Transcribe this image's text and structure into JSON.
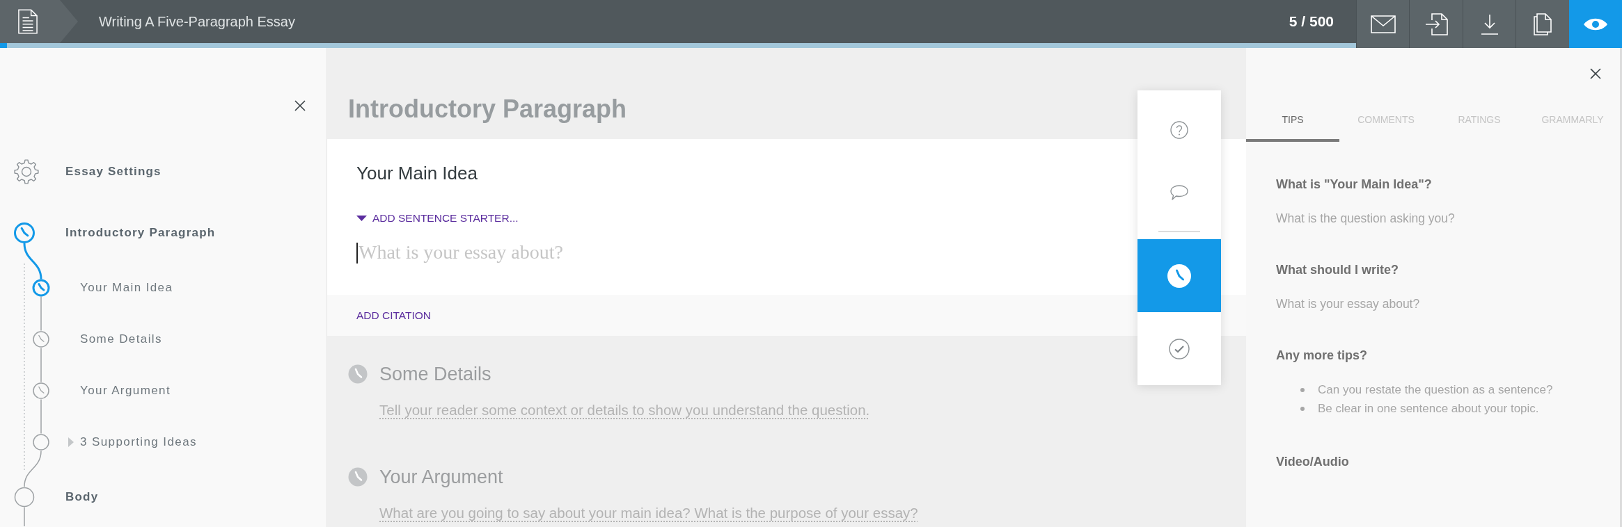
{
  "header": {
    "title": "Writing A Five-Paragraph Essay",
    "word_count": "5 / 500",
    "progress": {
      "level": 0.005
    },
    "actions": [
      {
        "kind": "email",
        "selected": false
      },
      {
        "kind": "import",
        "selected": false
      },
      {
        "kind": "download",
        "selected": false
      },
      {
        "kind": "copy",
        "selected": false
      },
      {
        "kind": "preview",
        "selected": true
      }
    ]
  },
  "sidebar": {
    "items": [
      {
        "kind": "settings",
        "label": "Essay Settings",
        "selected": false
      },
      {
        "kind": "section",
        "label": "Introductory Paragraph",
        "selected": true,
        "in_progress": true,
        "children": [
          {
            "label": "Your Main Idea",
            "selected": true,
            "in_progress": true
          },
          {
            "label": "Some Details",
            "selected": false,
            "in_progress": true
          },
          {
            "label": "Your Argument",
            "selected": false,
            "in_progress": true
          },
          {
            "label": "3 Supporting Ideas",
            "selected": false,
            "in_progress": false,
            "expanded": false
          }
        ]
      },
      {
        "kind": "section",
        "label": "Body",
        "selected": false,
        "in_progress": false
      }
    ]
  },
  "editor": {
    "title": "Introductory Paragraph",
    "current_step": {
      "title": "Your Main Idea",
      "starter_link": "ADD SENTENCE STARTER...",
      "placeholder": "What is your essay about?",
      "focused": true,
      "citation_link": "ADD CITATION"
    },
    "other_steps": [
      {
        "title": "Some Details",
        "prompt": "Tell your reader some context or details to show you understand the question.",
        "in_progress": true
      },
      {
        "title": "Your Argument",
        "prompt": "What are you going to say about your main idea? What is the purpose of your essay?",
        "in_progress": true
      }
    ]
  },
  "tool_rail": {
    "groups": [
      [
        {
          "kind": "help",
          "selected": false
        },
        {
          "kind": "comment",
          "selected": false
        }
      ],
      [
        {
          "kind": "progress",
          "selected": true
        },
        {
          "kind": "done",
          "selected": false
        }
      ]
    ]
  },
  "tips_panel": {
    "tabs": [
      {
        "label": "TIPS",
        "selected": true
      },
      {
        "label": "COMMENTS",
        "selected": false
      },
      {
        "label": "RATINGS",
        "selected": false
      },
      {
        "label": "GRAMMARLY",
        "selected": false
      }
    ],
    "sections": [
      {
        "kind": "text",
        "heading": "What is \"Your Main Idea\"?",
        "body": "What is the question asking you?"
      },
      {
        "kind": "text",
        "heading": "What should I write?",
        "body": "What is your essay about?"
      },
      {
        "kind": "list",
        "heading": "Any more tips?",
        "items": [
          "Can you restate the question as a sentence?",
          "Be clear in one sentence about your topic."
        ]
      },
      {
        "kind": "media",
        "heading": "Video/Audio"
      }
    ]
  }
}
